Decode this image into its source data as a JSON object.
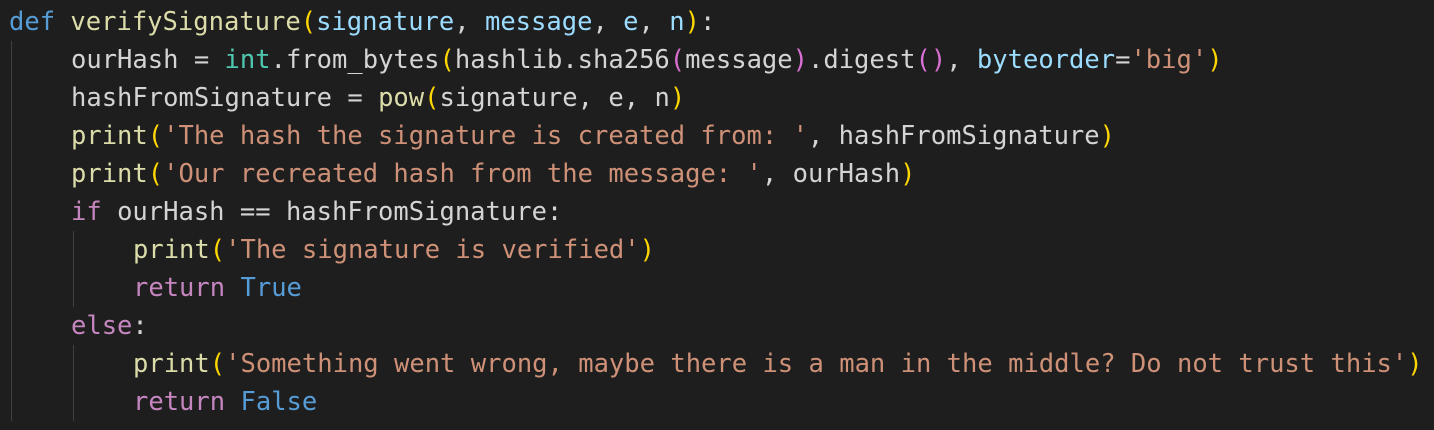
{
  "editor": {
    "language": "python",
    "lines": [
      {
        "indent": 0,
        "tokens": [
          {
            "t": "def",
            "c": "kw"
          },
          {
            "t": " ",
            "c": "plain"
          },
          {
            "t": "verifySignature",
            "c": "fn"
          },
          {
            "t": "(",
            "c": "p1"
          },
          {
            "t": "signature",
            "c": "param"
          },
          {
            "t": ", ",
            "c": "plain"
          },
          {
            "t": "message",
            "c": "param"
          },
          {
            "t": ", ",
            "c": "plain"
          },
          {
            "t": "e",
            "c": "param"
          },
          {
            "t": ", ",
            "c": "plain"
          },
          {
            "t": "n",
            "c": "param"
          },
          {
            "t": ")",
            "c": "p1"
          },
          {
            "t": ":",
            "c": "plain"
          }
        ]
      },
      {
        "indent": 1,
        "tokens": [
          {
            "t": "ourHash",
            "c": "plain"
          },
          {
            "t": " = ",
            "c": "plain"
          },
          {
            "t": "int",
            "c": "cls"
          },
          {
            "t": ".",
            "c": "plain"
          },
          {
            "t": "from_bytes",
            "c": "plain"
          },
          {
            "t": "(",
            "c": "p1"
          },
          {
            "t": "hashlib",
            "c": "plain"
          },
          {
            "t": ".",
            "c": "plain"
          },
          {
            "t": "sha256",
            "c": "plain"
          },
          {
            "t": "(",
            "c": "p2"
          },
          {
            "t": "message",
            "c": "plain"
          },
          {
            "t": ")",
            "c": "p2"
          },
          {
            "t": ".",
            "c": "plain"
          },
          {
            "t": "digest",
            "c": "plain"
          },
          {
            "t": "(",
            "c": "p2"
          },
          {
            "t": ")",
            "c": "p2"
          },
          {
            "t": ", ",
            "c": "plain"
          },
          {
            "t": "byteorder",
            "c": "param"
          },
          {
            "t": "=",
            "c": "plain"
          },
          {
            "t": "'big'",
            "c": "str"
          },
          {
            "t": ")",
            "c": "p1"
          }
        ]
      },
      {
        "indent": 1,
        "tokens": [
          {
            "t": "hashFromSignature",
            "c": "plain"
          },
          {
            "t": " = ",
            "c": "plain"
          },
          {
            "t": "pow",
            "c": "fn"
          },
          {
            "t": "(",
            "c": "p1"
          },
          {
            "t": "signature",
            "c": "plain"
          },
          {
            "t": ", ",
            "c": "plain"
          },
          {
            "t": "e",
            "c": "plain"
          },
          {
            "t": ", ",
            "c": "plain"
          },
          {
            "t": "n",
            "c": "plain"
          },
          {
            "t": ")",
            "c": "p1"
          }
        ]
      },
      {
        "indent": 1,
        "tokens": [
          {
            "t": "print",
            "c": "fn"
          },
          {
            "t": "(",
            "c": "p1"
          },
          {
            "t": "'The hash the signature is created from: '",
            "c": "str"
          },
          {
            "t": ", ",
            "c": "plain"
          },
          {
            "t": "hashFromSignature",
            "c": "plain"
          },
          {
            "t": ")",
            "c": "p1"
          }
        ]
      },
      {
        "indent": 1,
        "tokens": [
          {
            "t": "print",
            "c": "fn"
          },
          {
            "t": "(",
            "c": "p1"
          },
          {
            "t": "'Our recreated hash from the message: '",
            "c": "str"
          },
          {
            "t": ", ",
            "c": "plain"
          },
          {
            "t": "ourHash",
            "c": "plain"
          },
          {
            "t": ")",
            "c": "p1"
          }
        ]
      },
      {
        "indent": 1,
        "tokens": [
          {
            "t": "if",
            "c": "ctl"
          },
          {
            "t": " ourHash == hashFromSignature:",
            "c": "plain"
          }
        ]
      },
      {
        "indent": 2,
        "tokens": [
          {
            "t": "print",
            "c": "fn"
          },
          {
            "t": "(",
            "c": "p1"
          },
          {
            "t": "'The signature is verified'",
            "c": "str"
          },
          {
            "t": ")",
            "c": "p1"
          }
        ]
      },
      {
        "indent": 2,
        "tokens": [
          {
            "t": "return",
            "c": "ctl"
          },
          {
            "t": " ",
            "c": "plain"
          },
          {
            "t": "True",
            "c": "kw"
          }
        ]
      },
      {
        "indent": 1,
        "tokens": [
          {
            "t": "else",
            "c": "ctl"
          },
          {
            "t": ":",
            "c": "plain"
          }
        ]
      },
      {
        "indent": 2,
        "tokens": [
          {
            "t": "print",
            "c": "fn"
          },
          {
            "t": "(",
            "c": "p1"
          },
          {
            "t": "'Something went wrong, maybe there is a man in the middle? Do not trust this'",
            "c": "str"
          },
          {
            "t": ")",
            "c": "p1"
          }
        ]
      },
      {
        "indent": 2,
        "tokens": [
          {
            "t": "return",
            "c": "ctl"
          },
          {
            "t": " ",
            "c": "plain"
          },
          {
            "t": "False",
            "c": "kw"
          }
        ]
      }
    ]
  },
  "colors": {
    "background": "#1e1e1e",
    "keyword": "#569cd6",
    "control": "#c586c0",
    "function": "#dcdcaa",
    "parameter": "#9cdcfe",
    "string": "#ce9178",
    "class": "#4ec9b0",
    "text": "#d4d4d4",
    "bracket_level_1": "#ffd700",
    "bracket_level_2": "#da70d6"
  }
}
